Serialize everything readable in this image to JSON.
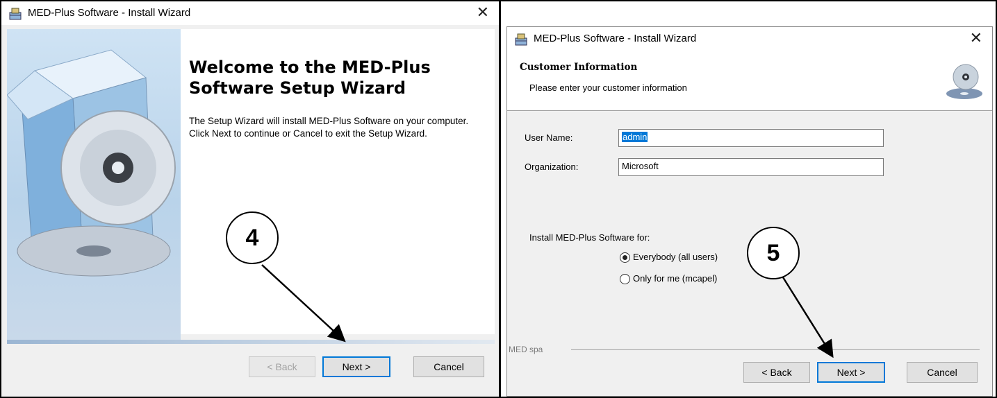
{
  "left": {
    "title": "MED-Plus Software - Install Wizard",
    "close": "✕",
    "heading_line1": "Welcome to the MED-Plus",
    "heading_line2": "Software Setup Wizard",
    "description": "The Setup Wizard will install MED-Plus Software on your computer. Click Next to continue or Cancel to exit the Setup Wizard.",
    "buttons": {
      "back": "< Back",
      "next": "Next >",
      "cancel": "Cancel"
    },
    "callout": "4"
  },
  "right": {
    "title": "MED-Plus Software - Install Wizard",
    "close": "✕",
    "header_title": "Customer Information",
    "header_subtitle": "Please enter your customer information",
    "user_name_label": "User Name:",
    "user_name_value": "admin",
    "organization_label": "Organization:",
    "organization_value": "Microsoft",
    "install_for_label": "Install MED-Plus Software for:",
    "options": [
      {
        "label": "Everybody (all users)",
        "selected": true
      },
      {
        "label": "Only for me (mcapel)",
        "selected": false
      }
    ],
    "footer_brand": "MED spa",
    "buttons": {
      "back": "< Back",
      "next": "Next >",
      "cancel": "Cancel"
    },
    "callout": "5"
  }
}
